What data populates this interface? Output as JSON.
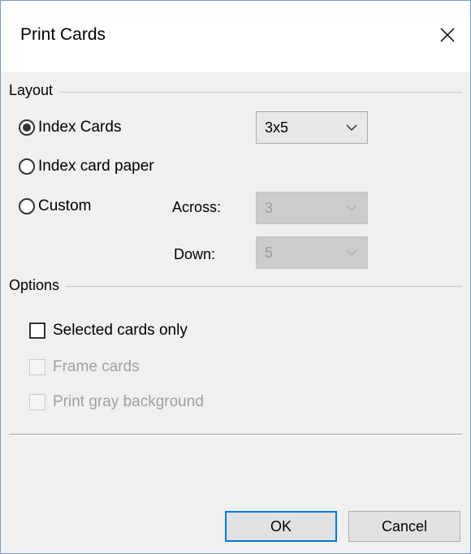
{
  "dialog": {
    "title": "Print Cards",
    "close_icon": "close-icon"
  },
  "layout": {
    "group_label": "Layout",
    "options": [
      {
        "label": "Index Cards",
        "selected": true
      },
      {
        "label": "Index card paper",
        "selected": false
      },
      {
        "label": "Custom",
        "selected": false
      }
    ],
    "card_size": {
      "value": "3x5",
      "enabled": true
    },
    "across": {
      "label": "Across:",
      "value": "3",
      "enabled": false
    },
    "down": {
      "label": "Down:",
      "value": "5",
      "enabled": false
    }
  },
  "options": {
    "group_label": "Options",
    "checkboxes": [
      {
        "label": "Selected cards only",
        "checked": false,
        "enabled": true
      },
      {
        "label": "Frame cards",
        "checked": false,
        "enabled": false
      },
      {
        "label": "Print gray background",
        "checked": false,
        "enabled": false
      }
    ]
  },
  "buttons": {
    "ok_label": "OK",
    "cancel_label": "Cancel"
  },
  "colors": {
    "accent": "#0078d7",
    "dialog_bg": "#f0f0f0",
    "disabled_text": "#a0a0a0"
  }
}
